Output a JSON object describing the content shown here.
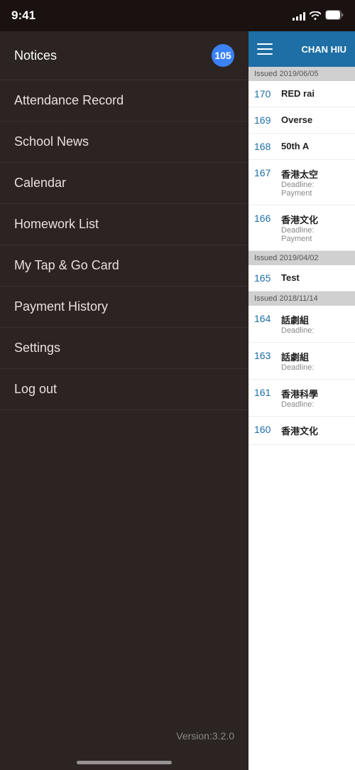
{
  "statusBar": {
    "time": "9:41",
    "signalBars": [
      4,
      6,
      8,
      10,
      12
    ],
    "icons": [
      "wifi",
      "battery"
    ]
  },
  "sidebar": {
    "items": [
      {
        "label": "Notices",
        "badge": "105",
        "hasBadge": true
      },
      {
        "label": "Attendance Record",
        "hasBadge": false
      },
      {
        "label": "School News",
        "hasBadge": false
      },
      {
        "label": "Calendar",
        "hasBadge": false
      },
      {
        "label": "Homework List",
        "hasBadge": false
      },
      {
        "label": "My Tap & Go Card",
        "hasBadge": false
      },
      {
        "label": "Payment History",
        "hasBadge": false
      },
      {
        "label": "Settings",
        "hasBadge": false
      },
      {
        "label": "Log out",
        "hasBadge": false
      }
    ],
    "version": "Version:3.2.0"
  },
  "rightPanel": {
    "userName": "CHAN HIU",
    "menuIcon": "hamburger",
    "dateSections": [
      {
        "date": "Issued 2019/06/05",
        "notices": [
          {
            "number": "170",
            "title": "RED rai",
            "subtitle": ""
          },
          {
            "number": "169",
            "title": "Overse",
            "subtitle": ""
          },
          {
            "number": "168",
            "title": "50th A",
            "subtitle": ""
          },
          {
            "number": "167",
            "title": "香港太空",
            "subtitle": "Deadline: Payment"
          },
          {
            "number": "166",
            "title": "香港文化",
            "subtitle": "Deadline: Payment"
          }
        ]
      },
      {
        "date": "Issued 2019/04/02",
        "notices": [
          {
            "number": "165",
            "title": "Test",
            "subtitle": ""
          }
        ]
      },
      {
        "date": "Issued 2018/11/14",
        "notices": [
          {
            "number": "164",
            "title": "話劇組",
            "subtitle": "Deadline:"
          },
          {
            "number": "163",
            "title": "話劇組",
            "subtitle": "Deadline:"
          },
          {
            "number": "161",
            "title": "香港科學",
            "subtitle": "Deadline:"
          },
          {
            "number": "160",
            "title": "香港文化",
            "subtitle": ""
          }
        ]
      }
    ]
  }
}
